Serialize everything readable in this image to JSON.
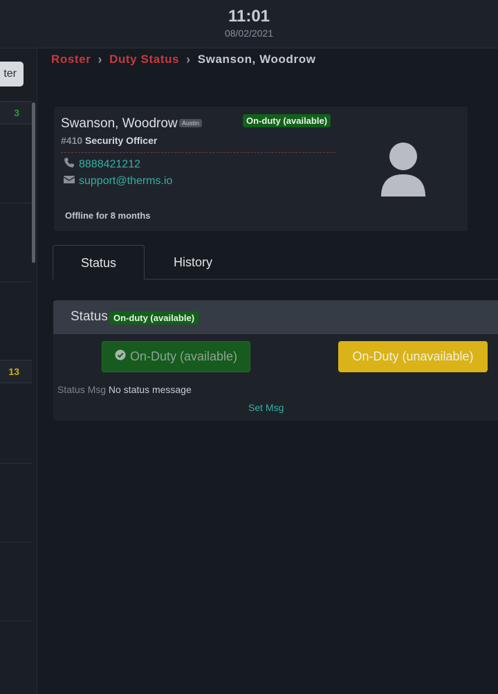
{
  "header": {
    "time": "11:01",
    "date": "08/02/2021"
  },
  "sidebar": {
    "filter_label": "ter",
    "counts": [
      {
        "value": "3",
        "color": "#2f9a3a"
      },
      {
        "value": "13",
        "color": "#d2b112"
      }
    ]
  },
  "breadcrumb": {
    "items": [
      "Roster",
      "Duty Status",
      "Swanson, Woodrow"
    ]
  },
  "profile": {
    "name": "Swanson, Woodrow",
    "location_badge": "Austin",
    "status_pill": "On-duty (available)",
    "badge_number": "#410",
    "role": "Security Officer",
    "phone": "8888421212",
    "email": "support@therms.io",
    "offline_text": "Offline for 8 months",
    "avatar_icon": "user-silhouette-icon"
  },
  "tabs": [
    {
      "label": "Status",
      "active": true
    },
    {
      "label": "History",
      "active": false
    }
  ],
  "status": {
    "title": "Status",
    "current_pill": "On-duty (available)",
    "btn_available": "On-Duty (available)",
    "btn_unavailable": "On-Duty (unavailable)",
    "msg_label": "Status Msg",
    "msg_value": "No status message",
    "set_msg": "Set Msg"
  },
  "colors": {
    "accent_red": "#c73a3f",
    "accent_teal": "#34b0a3",
    "available_green": "#126019",
    "unavailable_yellow": "#d9b317"
  }
}
